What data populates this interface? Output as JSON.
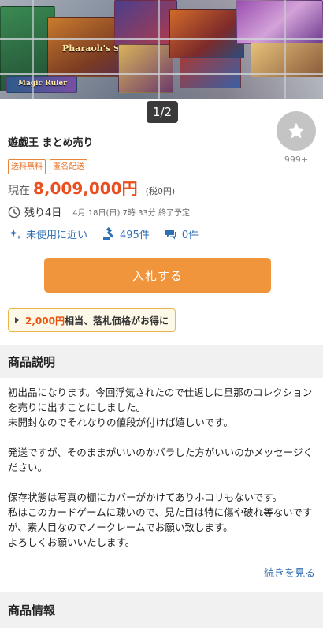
{
  "gallery": {
    "pager": "1/2"
  },
  "item": {
    "title": "遊戯王 まとめ売り",
    "watch_count": "999+",
    "badges": [
      "送料無料",
      "匿名配送"
    ],
    "price_label": "現在",
    "price": "8,009,000円",
    "tax_note": "(税0円)",
    "remaining": "残り4日",
    "end_time": "4月 18日(日) 7時 33分 終了予定",
    "condition": "未使用に近い",
    "bids": "495件",
    "comments": "0件",
    "bid_button": "入札する",
    "promo_amount": "2,000円",
    "promo_text": "相当、落札価格がお得に"
  },
  "photo_labels": [
    "Pharaoh's Servant",
    "Magic Ruler"
  ],
  "description": {
    "heading": "商品説明",
    "paragraphs": [
      "初出品になります。今回浮気されたので仕返しに旦那のコレクションを売りに出すことにしました。",
      "未開封なのでそれなりの値段が付けば嬉しいです。",
      "",
      "発送ですが、そのままがいいのかバラした方がいいのかメッセージください。",
      "",
      "保存状態は写真の棚にカバーがかけてありホコリもないです。",
      "私はこのカードゲームに疎いので、見た目は特に傷や破れ等ないですが、素人目なのでノークレームでお願い致します。",
      "よろしくお願いいたします。"
    ],
    "more_link": "続きを見る"
  },
  "info": {
    "heading": "商品情報"
  },
  "colors": {
    "accent": "#f0953b",
    "price": "#ea4f1f",
    "link": "#2f6fb3",
    "badge": "#e8843a"
  }
}
